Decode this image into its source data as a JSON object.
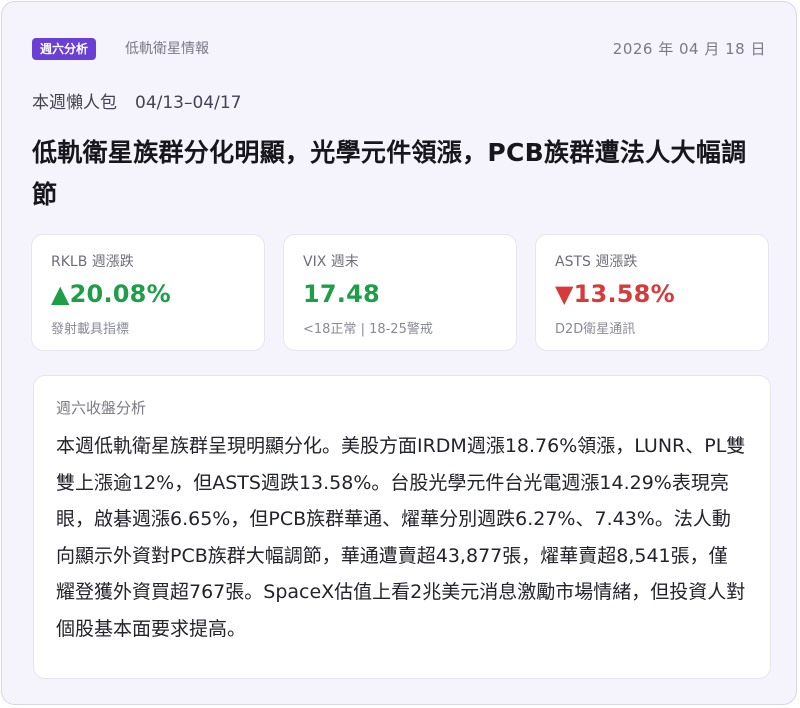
{
  "header": {
    "badge": "週六分析",
    "tagline": "低軌衛星情報",
    "date": "2026 年 04 月 18 日"
  },
  "period": {
    "label": "本週懶人包",
    "range": "04/13–04/17"
  },
  "headline": "低軌衛星族群分化明顯，光學元件領漲，PCB族群遭法人大幅調節",
  "stats": [
    {
      "label": "RKLB 週漲跌",
      "value": "▲20.08%",
      "note": "發射載具指標",
      "trend": "up"
    },
    {
      "label": "VIX 週末",
      "value": "17.48",
      "note": "<18正常 | 18-25警戒",
      "trend": "flat"
    },
    {
      "label": "ASTS 週漲跌",
      "value": "▼13.58%",
      "note": "D2D衛星通訊",
      "trend": "down"
    }
  ],
  "analysis": {
    "title": "週六收盤分析",
    "body": "本週低軌衛星族群呈現明顯分化。美股方面IRDM週漲18.76%領漲，LUNR、PL雙雙上漲逾12%，但ASTS週跌13.58%。台股光學元件台光電週漲14.29%表現亮眼，啟碁週漲6.65%，但PCB族群華通、燿華分別週跌6.27%、7.43%。法人動向顯示外資對PCB族群大幅調節，華通遭賣超43,877張，燿華賣超8,541張，僅耀登獲外資買超767張。SpaceX估值上看2兆美元消息激勵市場情緒，但投資人對個股基本面要求提高。"
  },
  "colors": {
    "accent": "#6a3fd6",
    "up": "#1f9e4a",
    "down": "#d63a3a",
    "background": "#f5f3fb"
  }
}
